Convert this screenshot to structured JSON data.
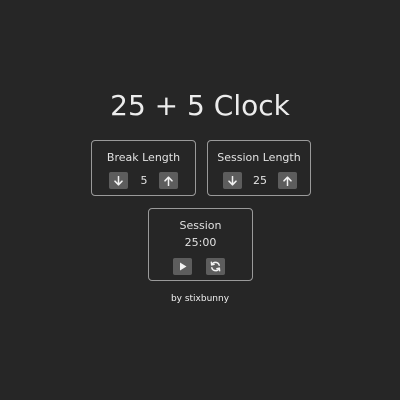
{
  "app": {
    "title": "25 + 5 Clock"
  },
  "break": {
    "label": "Break Length",
    "value": "5",
    "decrement_icon": "arrow-down-icon",
    "increment_icon": "arrow-up-icon"
  },
  "session": {
    "label": "Session Length",
    "value": "25",
    "decrement_icon": "arrow-down-icon",
    "increment_icon": "arrow-up-icon"
  },
  "timer": {
    "label": "Session",
    "time": "25:00",
    "play_icon": "play-icon",
    "reset_icon": "refresh-icon"
  },
  "footer": {
    "credit": "by stixbunny"
  },
  "colors": {
    "background": "#262626",
    "panel_border": "#9a9a9a",
    "button": "#5d5d5d",
    "text": "#e8e8e8"
  }
}
